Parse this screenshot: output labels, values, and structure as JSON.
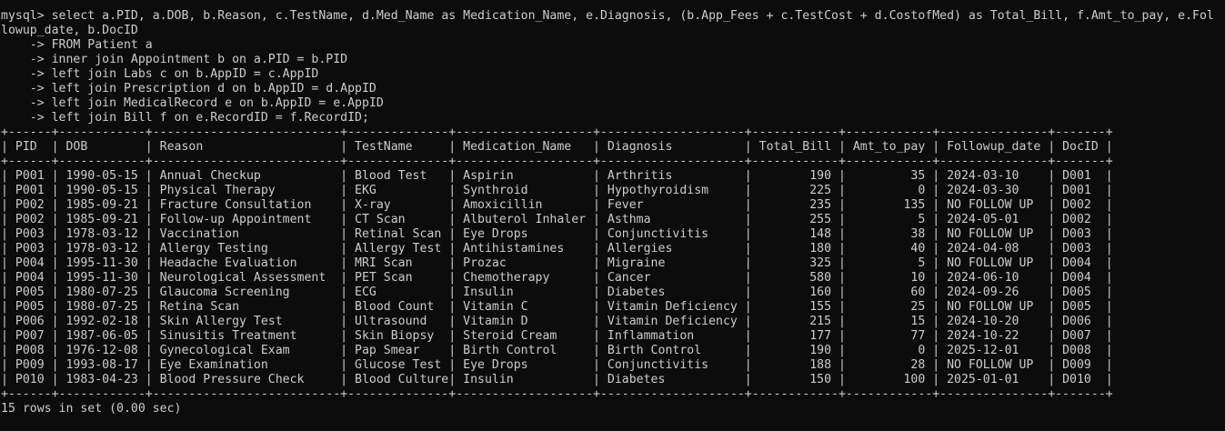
{
  "prompt": "mysql> ",
  "query_lines": [
    "select a.PID, a.DOB, b.Reason, c.TestName, d.Med_Name as Medication_Name, e.Diagnosis, (b.App_Fees + c.TestCost + d.CostofMed) as Total_Bill, f.Amt_to_pay, e.Fol",
    "lowup_date, b.DocID",
    "    -> FROM Patient a",
    "    -> inner join Appointment b on a.PID = b.PID",
    "    -> left join Labs c on b.AppID = c.AppID",
    "    -> left join Prescription d on b.AppID = d.AppID",
    "    -> left join MedicalRecord e on b.AppID = e.AppID",
    "    -> left join Bill f on e.RecordID = f.RecordID;"
  ],
  "table": {
    "border": "+------+------------+--------------------------+--------------+-------------------+--------------------+------------+------------+---------------+-------+",
    "header": "| PID  | DOB        | Reason                   | TestName     | Medication_Name   | Diagnosis          | Total_Bill | Amt_to_pay | Followup_date | DocID |",
    "rows": [
      "| P001 | 1990-05-15 | Annual Checkup           | Blood Test   | Aspirin           | Arthritis          |        190 |         35 | 2024-03-10    | D001  |",
      "| P001 | 1990-05-15 | Physical Therapy         | EKG          | Synthroid         | Hypothyroidism     |        225 |          0 | 2024-03-30    | D001  |",
      "| P002 | 1985-09-21 | Fracture Consultation    | X-ray        | Amoxicillin       | Fever              |        235 |        135 | NO FOLLOW UP  | D002  |",
      "| P002 | 1985-09-21 | Follow-up Appointment    | CT Scan      | Albuterol Inhaler | Asthma             |        255 |          5 | 2024-05-01    | D002  |",
      "| P003 | 1978-03-12 | Vaccination              | Retinal Scan | Eye Drops         | Conjunctivitis     |        148 |         38 | NO FOLLOW UP  | D003  |",
      "| P003 | 1978-03-12 | Allergy Testing          | Allergy Test | Antihistamines    | Allergies          |        180 |         40 | 2024-04-08    | D003  |",
      "| P004 | 1995-11-30 | Headache Evaluation      | MRI Scan     | Prozac            | Migraine           |        325 |          5 | NO FOLLOW UP  | D004  |",
      "| P004 | 1995-11-30 | Neurological Assessment  | PET Scan     | Chemotherapy      | Cancer             |        580 |         10 | 2024-06-10    | D004  |",
      "| P005 | 1980-07-25 | Glaucoma Screening       | ECG          | Insulin           | Diabetes           |        160 |         60 | 2024-09-26    | D005  |",
      "| P005 | 1980-07-25 | Retina Scan              | Blood Count  | Vitamin C         | Vitamin Deficiency |        155 |         25 | NO FOLLOW UP  | D005  |",
      "| P006 | 1992-02-18 | Skin Allergy Test        | Ultrasound   | Vitamin D         | Vitamin Deficiency |        215 |         15 | 2024-10-20    | D006  |",
      "| P007 | 1987-06-05 | Sinusitis Treatment      | Skin Biopsy  | Steroid Cream     | Inflammation       |        177 |         77 | 2024-10-22    | D007  |",
      "| P008 | 1976-12-08 | Gynecological Exam       | Pap Smear    | Birth Control     | Birth Control      |        190 |          0 | 2025-12-01    | D008  |",
      "| P009 | 1993-08-17 | Eye Examination          | Glucose Test | Eye Drops         | Conjunctivitis     |        188 |         28 | NO FOLLOW UP  | D009  |",
      "| P010 | 1983-04-23 | Blood Pressure Check     | Blood Culture| Insulin           | Diabetes           |        150 |        100 | 2025-01-01    | D010  |"
    ]
  },
  "status": "15 rows in set (0.00 sec)",
  "colors": {
    "background": "#0c0c0c",
    "text": "#cccccc"
  }
}
